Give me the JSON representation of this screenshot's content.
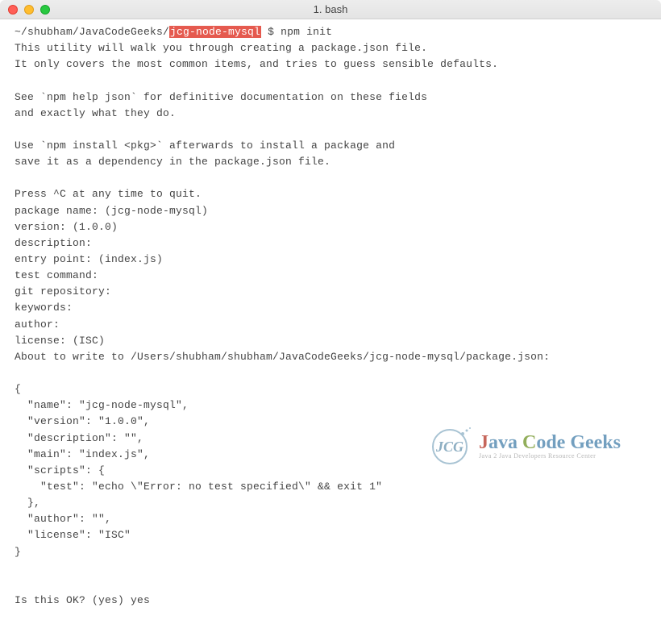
{
  "window": {
    "title": "1. bash"
  },
  "prompt": {
    "path_prefix": "~/shubham/JavaCodeGeeks/",
    "highlighted_dir": "jcg-node-mysql",
    "dollar": " $ ",
    "command": "npm init"
  },
  "output": {
    "l1": "This utility will walk you through creating a package.json file.",
    "l2": "It only covers the most common items, and tries to guess sensible defaults.",
    "l3": "",
    "l4": "See `npm help json` for definitive documentation on these fields",
    "l5": "and exactly what they do.",
    "l6": "",
    "l7": "Use `npm install <pkg>` afterwards to install a package and",
    "l8": "save it as a dependency in the package.json file.",
    "l9": "",
    "l10": "Press ^C at any time to quit.",
    "l11": "package name: (jcg-node-mysql)",
    "l12": "version: (1.0.0)",
    "l13": "description:",
    "l14": "entry point: (index.js)",
    "l15": "test command:",
    "l16": "git repository:",
    "l17": "keywords:",
    "l18": "author:",
    "l19": "license: (ISC)",
    "l20": "About to write to /Users/shubham/shubham/JavaCodeGeeks/jcg-node-mysql/package.json:",
    "l21": "",
    "l22": "{",
    "l23": "  \"name\": \"jcg-node-mysql\",",
    "l24": "  \"version\": \"1.0.0\",",
    "l25": "  \"description\": \"\",",
    "l26": "  \"main\": \"index.js\",",
    "l27": "  \"scripts\": {",
    "l28": "    \"test\": \"echo \\\"Error: no test specified\\\" && exit 1\"",
    "l29": "  },",
    "l30": "  \"author\": \"\",",
    "l31": "  \"license\": \"ISC\"",
    "l32": "}",
    "l33": "",
    "l34": "",
    "l35": "Is this OK? (yes) yes"
  },
  "watermark": {
    "logo_text": "JCG",
    "main_j": "J",
    "main_java": "ava ",
    "main_c": "C",
    "main_code": "ode ",
    "main_g": "G",
    "main_geeks": "eeks",
    "sub": "Java 2 Java Developers Resource Center"
  }
}
